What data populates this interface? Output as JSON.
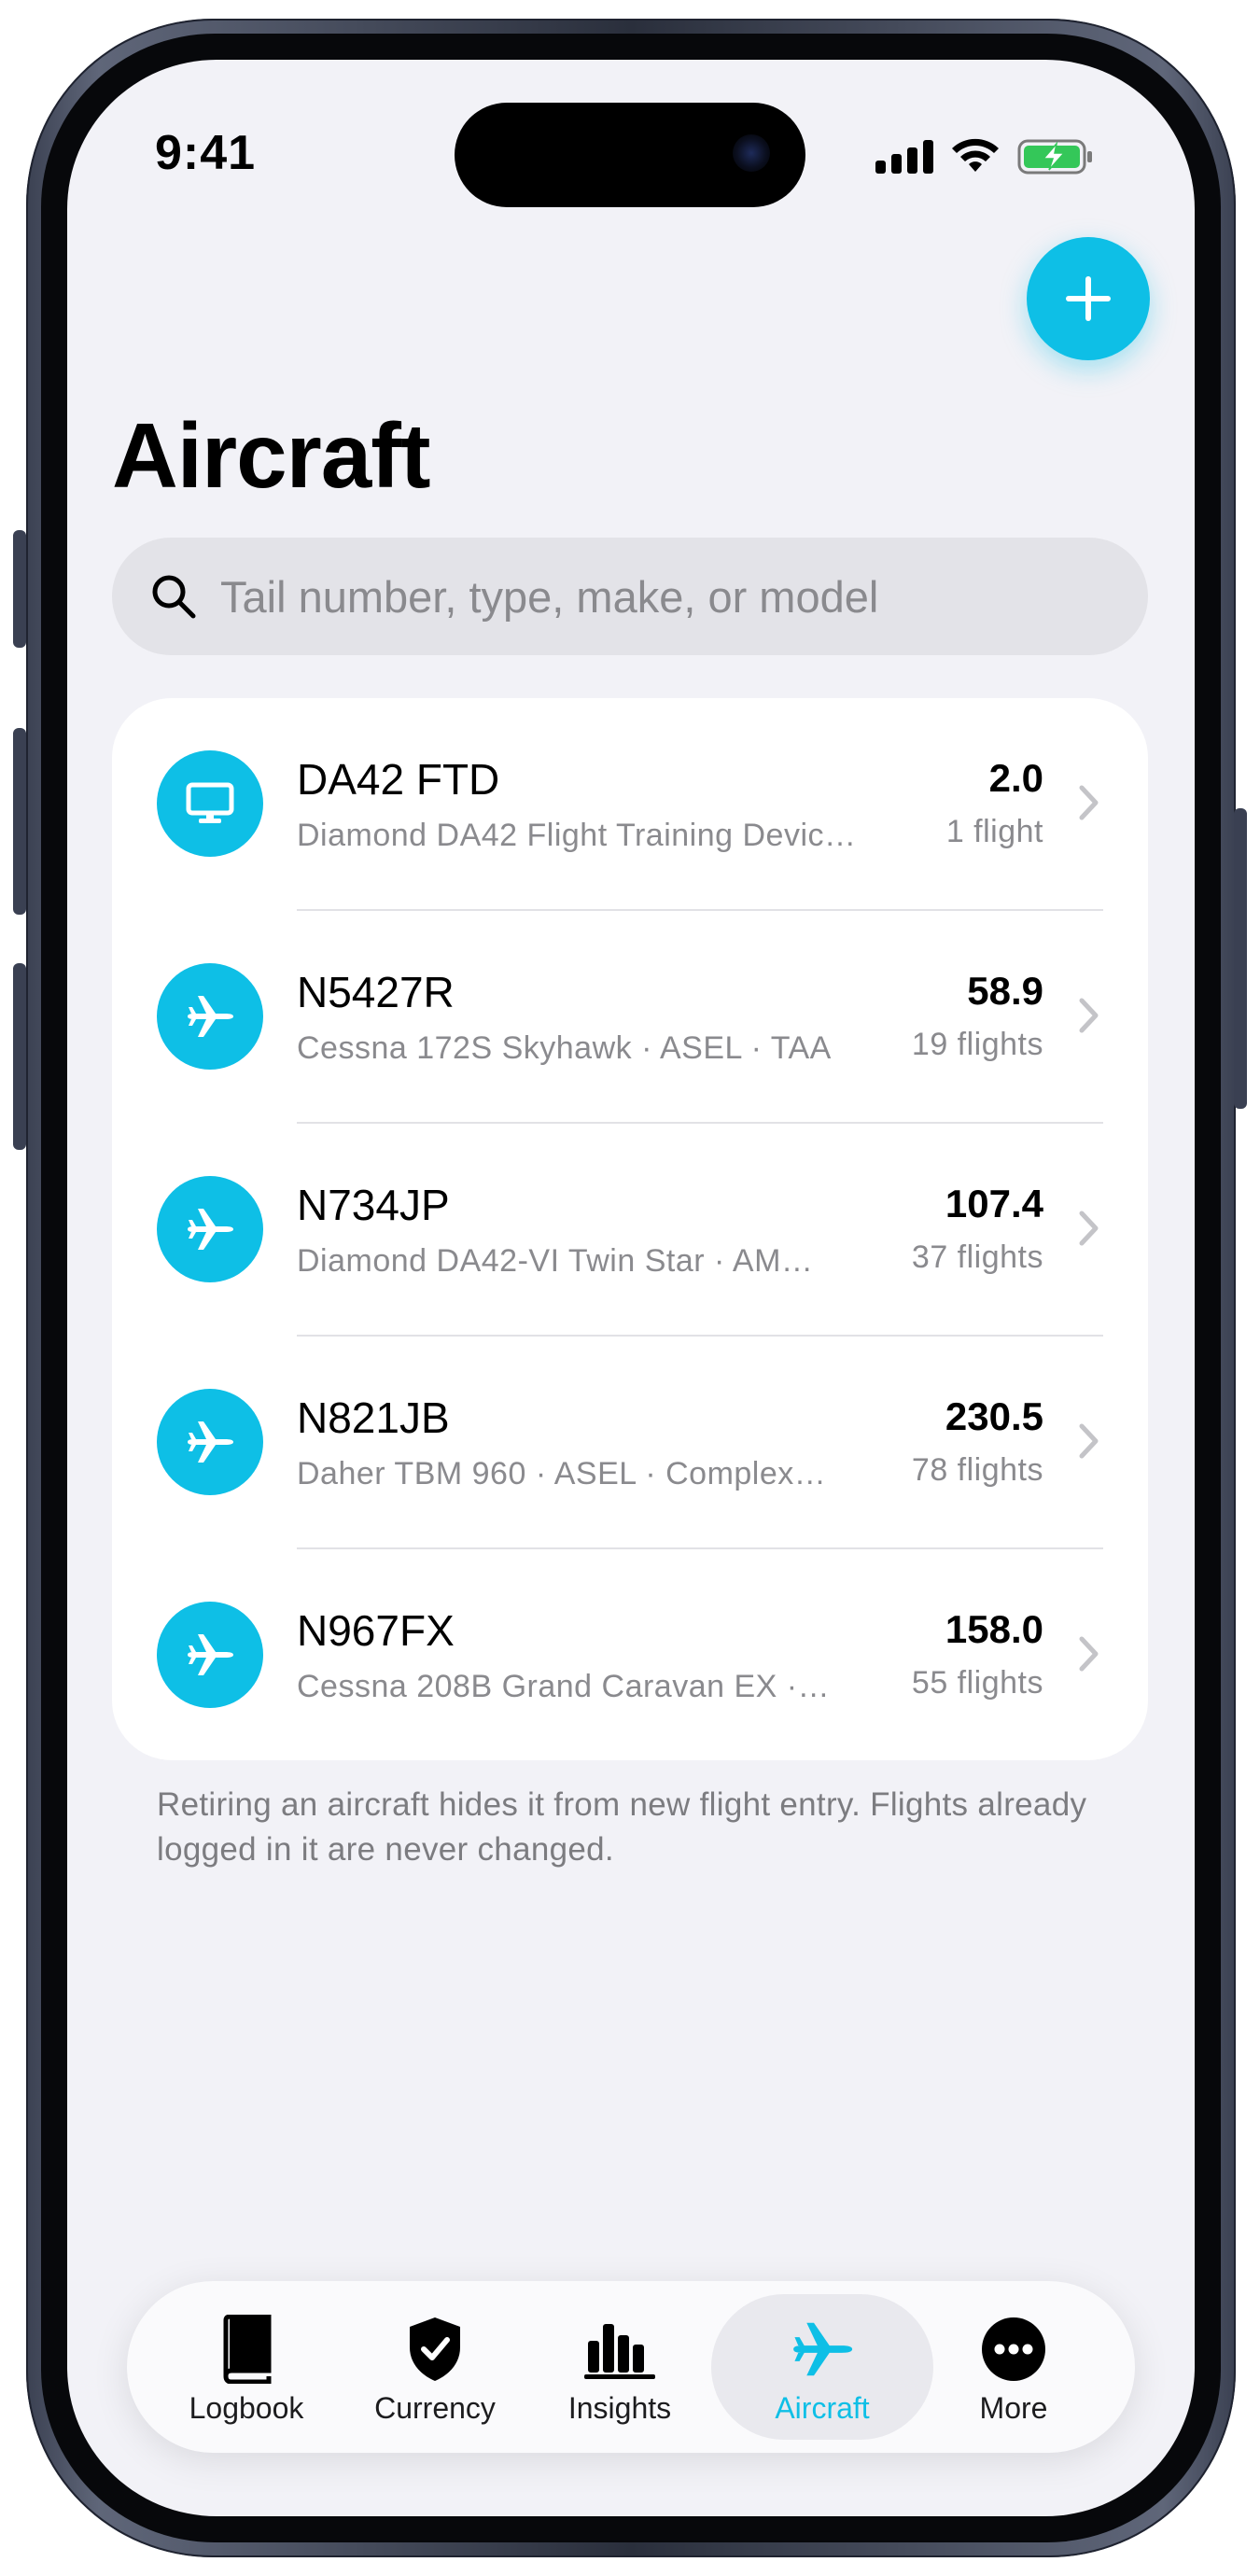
{
  "status_bar": {
    "time": "9:41"
  },
  "header": {
    "title": "Aircraft",
    "add_icon": "plus-icon"
  },
  "search": {
    "placeholder": "Tail number, type, make, or model",
    "icon": "search-icon"
  },
  "aircraft": [
    {
      "tail": "DA42 FTD",
      "description": "Diamond DA42 Flight Training Devic…",
      "hours": "2.0",
      "flights": "1 flight",
      "icon": "monitor-icon"
    },
    {
      "tail": "N5427R",
      "description": "Cessna 172S Skyhawk · ASEL · TAA",
      "hours": "58.9",
      "flights": "19 flights",
      "icon": "airplane-icon"
    },
    {
      "tail": "N734JP",
      "description": "Diamond DA42-VI Twin Star · AM…",
      "hours": "107.4",
      "flights": "37 flights",
      "icon": "airplane-icon"
    },
    {
      "tail": "N821JB",
      "description": "Daher TBM 960 · ASEL · Complex…",
      "hours": "230.5",
      "flights": "78 flights",
      "icon": "airplane-icon"
    },
    {
      "tail": "N967FX",
      "description": "Cessna 208B Grand Caravan EX ·…",
      "hours": "158.0",
      "flights": "55 flights",
      "icon": "airplane-icon"
    }
  ],
  "footer_note": "Retiring an aircraft hides it from new flight entry. Flights already logged in it are never changed.",
  "tabs": [
    {
      "label": "Logbook",
      "icon": "book-icon",
      "active": false
    },
    {
      "label": "Currency",
      "icon": "shield-check-icon",
      "active": false
    },
    {
      "label": "Insights",
      "icon": "bar-chart-icon",
      "active": false
    },
    {
      "label": "Aircraft",
      "icon": "airplane-icon",
      "active": true
    },
    {
      "label": "More",
      "icon": "ellipsis-circle-icon",
      "active": false
    }
  ],
  "colors": {
    "accent": "#0ebfe6",
    "background": "#f2f2f7",
    "secondary_text": "#8a8a8e"
  }
}
